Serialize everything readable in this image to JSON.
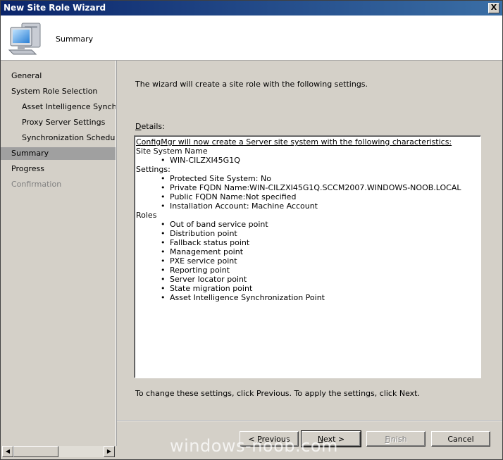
{
  "window": {
    "title": "New Site Role Wizard",
    "close_glyph": "X"
  },
  "header": {
    "title": "Summary",
    "icon": "computer-icon"
  },
  "sidebar": {
    "items": [
      {
        "label": "General",
        "state": "normal"
      },
      {
        "label": "System Role Selection",
        "state": "normal"
      },
      {
        "label": "Asset Intelligence Synchronization Point",
        "state": "normal"
      },
      {
        "label": "Proxy Server Settings",
        "state": "normal"
      },
      {
        "label": "Synchronization Schedule",
        "state": "normal"
      },
      {
        "label": "Summary",
        "state": "active"
      },
      {
        "label": "Progress",
        "state": "normal"
      },
      {
        "label": "Confirmation",
        "state": "disabled"
      }
    ]
  },
  "main": {
    "intro": "The wizard will create a site role with the following settings.",
    "details_label_accel": "D",
    "details_label_rest": "etails:",
    "details": {
      "heading": "ConfigMgr will now create a Server site system with the following characteristics:",
      "site_system_label": "Site System Name",
      "site_system_items": [
        "WIN-CILZXI45G1Q"
      ],
      "settings_label": "Settings:",
      "settings_items": [
        "Protected Site System: No",
        "Private FQDN Name:WIN-CILZXI45G1Q.SCCM2007.WINDOWS-NOOB.LOCAL",
        "Public FQDN Name:Not specified",
        "Installation Account: Machine Account"
      ],
      "roles_label": "Roles",
      "roles_items": [
        "Out of band service point",
        "Distribution point",
        "Fallback status point",
        "Management point",
        "PXE service point",
        "Reporting point",
        "Server locator point",
        "State migration point",
        "Asset Intelligence Synchronization Point"
      ]
    },
    "footer_text": "To change these settings, click Previous. To apply the settings, click Next."
  },
  "buttons": {
    "previous_prefix": "< ",
    "previous_accel": "P",
    "previous_rest": "revious",
    "next_accel": "N",
    "next_rest": "ext >",
    "finish_accel": "F",
    "finish_rest": "inish",
    "cancel": "Cancel"
  },
  "scrollbar": {
    "left_arrow": "◀",
    "right_arrow": "▶"
  },
  "watermark": "windows-noob.com"
}
